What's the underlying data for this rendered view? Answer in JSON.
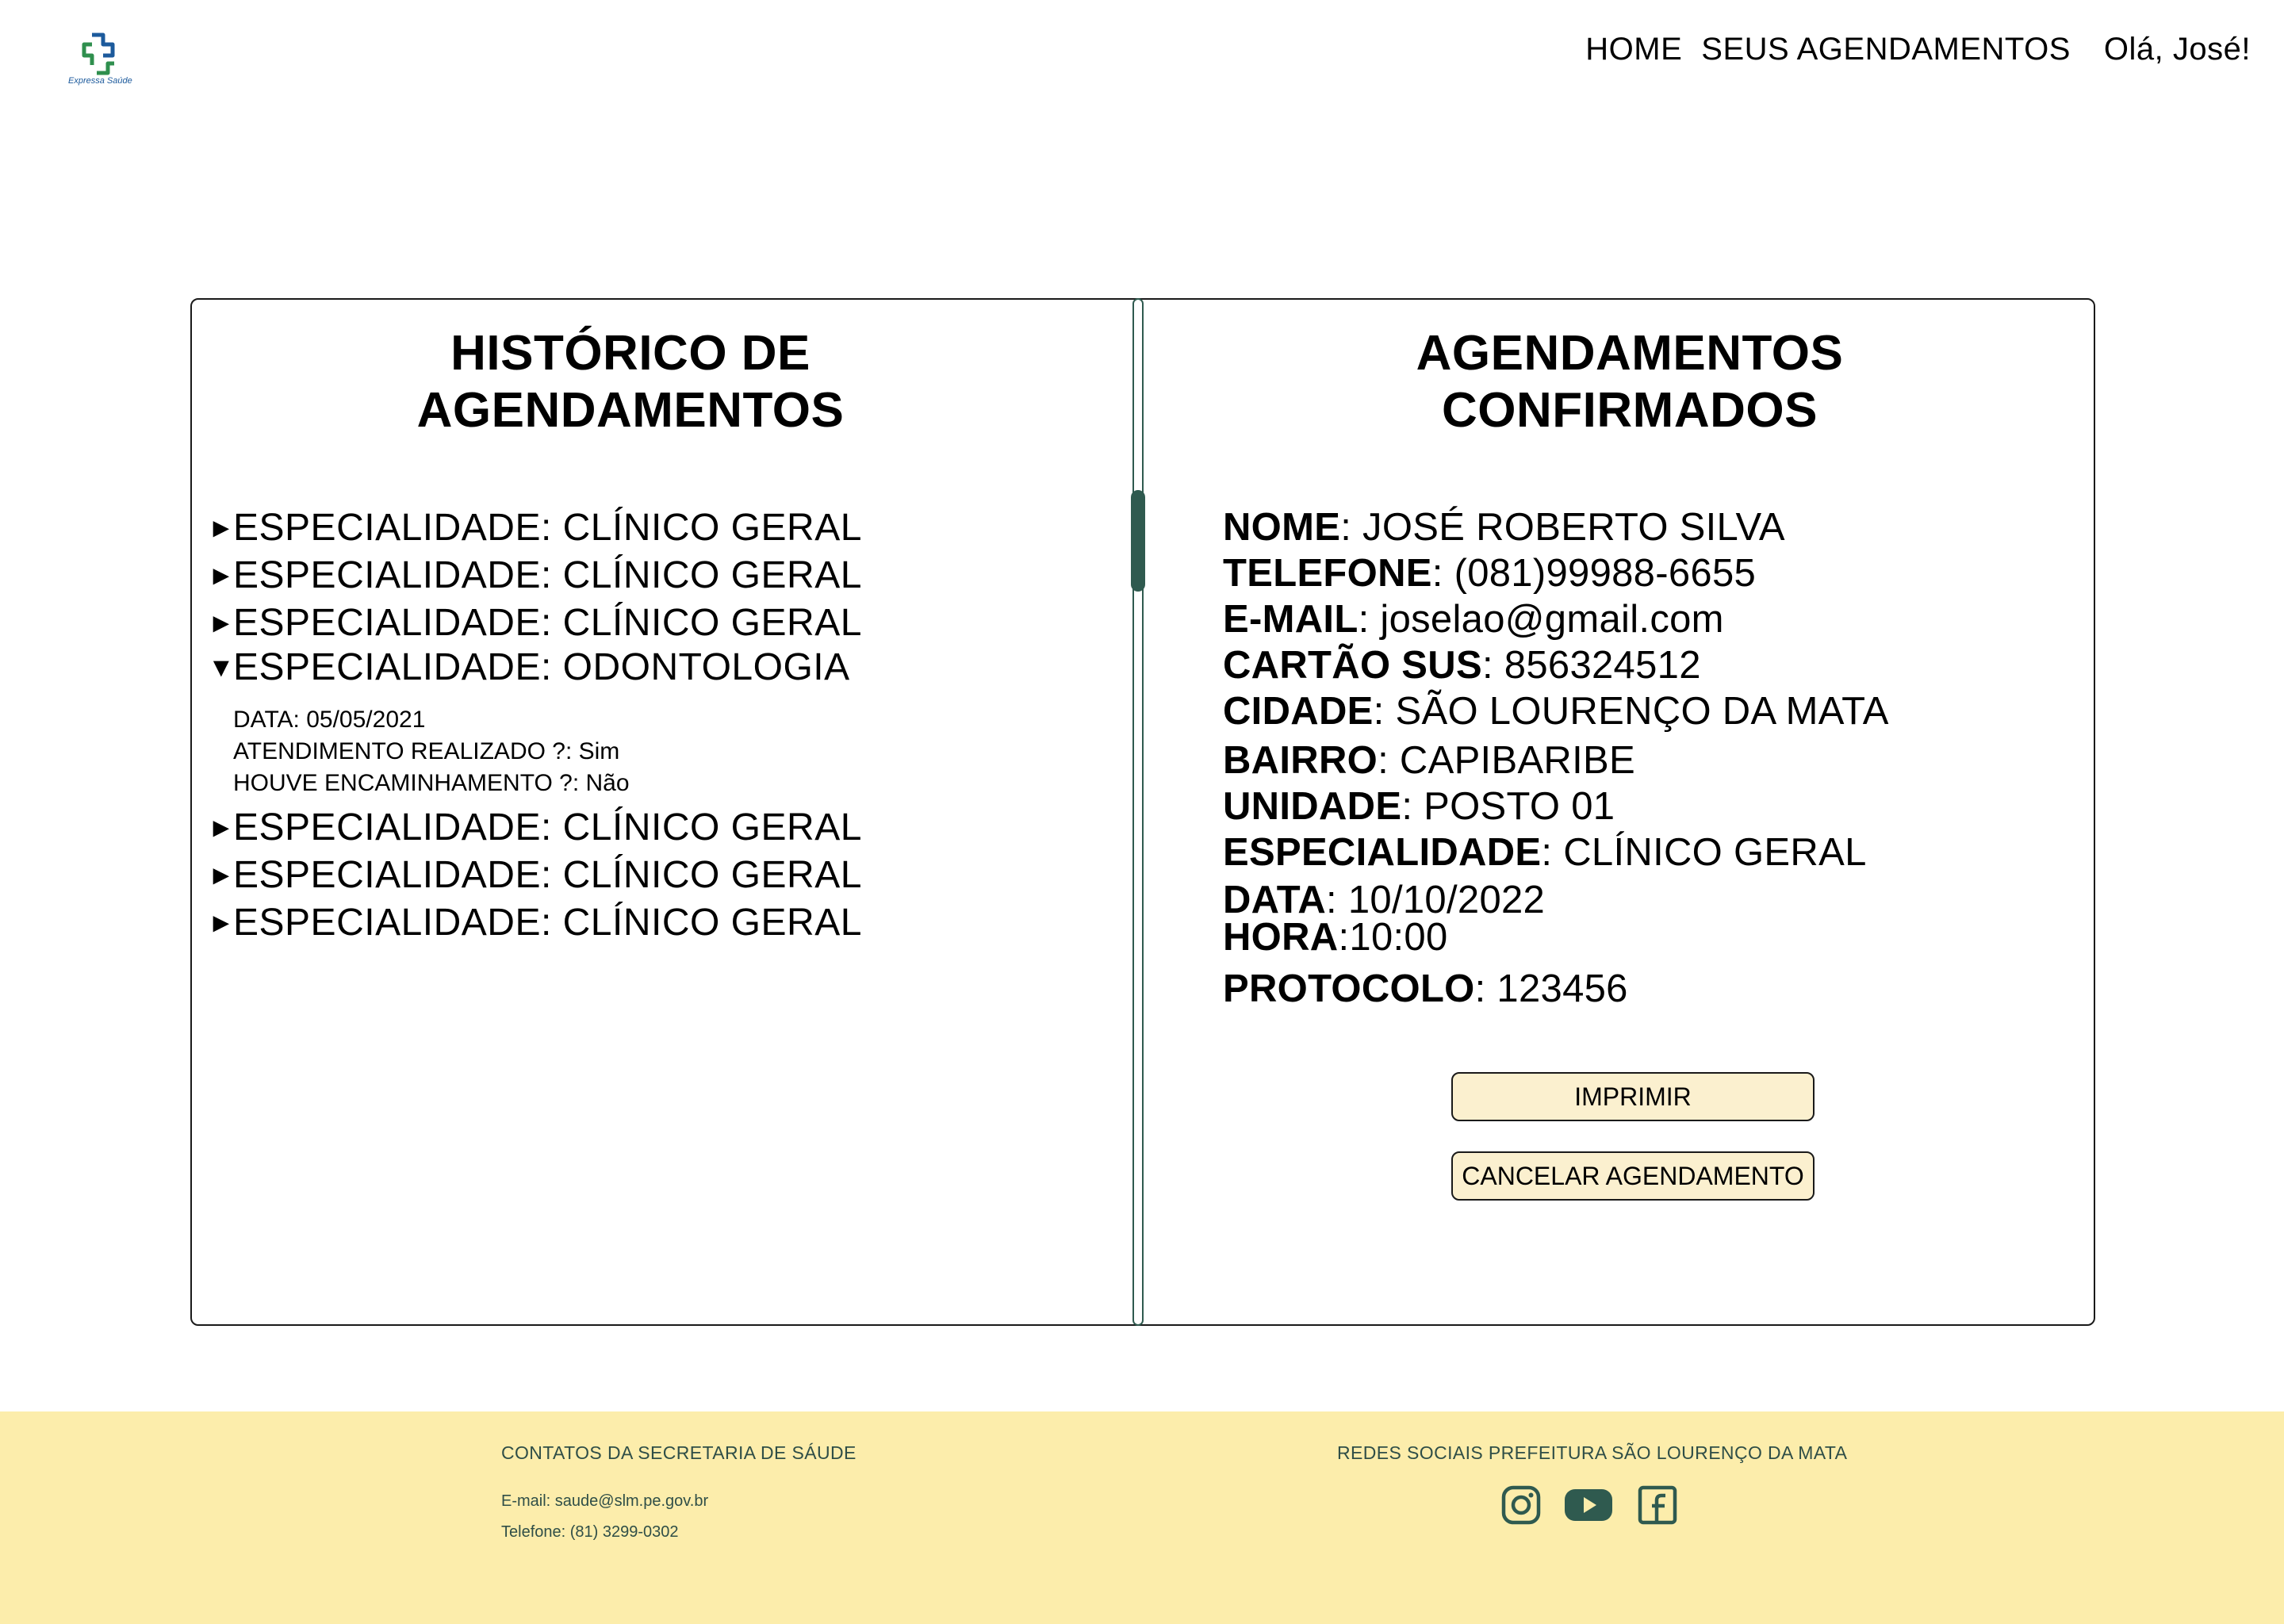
{
  "header": {
    "logo_text": "Expressa Saúde",
    "nav": {
      "home": "HOME",
      "appointments": "SEUS AGENDAMENTOS",
      "greeting": "Olá, José!"
    }
  },
  "history": {
    "title_line1": "HISTÓRICO DE",
    "title_line2": "AGENDAMENTOS",
    "items": [
      {
        "arrow": "►",
        "label": "ESPECIALIDADE: CLÍNICO GERAL"
      },
      {
        "arrow": "►",
        "label": "ESPECIALIDADE: CLÍNICO GERAL"
      },
      {
        "arrow": "►",
        "label": "ESPECIALIDADE: CLÍNICO GERAL"
      },
      {
        "arrow": "▼",
        "label": "ESPECIALIDADE: ODONTOLOGIA"
      },
      {
        "arrow": "►",
        "label": "ESPECIALIDADE: CLÍNICO GERAL"
      },
      {
        "arrow": "►",
        "label": "ESPECIALIDADE: CLÍNICO GERAL"
      },
      {
        "arrow": "►",
        "label": "ESPECIALIDADE: CLÍNICO GERAL"
      }
    ],
    "expanded_details": {
      "date": "DATA: 05/05/2021",
      "attended": "ATENDIMENTO REALIZADO ?: Sim",
      "referral": "HOUVE ENCAMINHAMENTO ?: Não"
    }
  },
  "confirmed": {
    "title_line1": "AGENDAMENTOS",
    "title_line2": "CONFIRMADOS",
    "fields": [
      {
        "label": "NOME",
        "sep": ": ",
        "value": "JOSÉ ROBERTO SILVA"
      },
      {
        "label": "TELEFONE",
        "sep": ": ",
        "value": "(081)99988-6655"
      },
      {
        "label": "E-MAIL",
        "sep": ": ",
        "value": "joselao@gmail.com"
      },
      {
        "label": "CARTÃO SUS",
        "sep": ": ",
        "value": "856324512"
      },
      {
        "label": "CIDADE",
        "sep": ": ",
        "value": "SÃO LOURENÇO DA MATA"
      },
      {
        "label": "BAIRRO",
        "sep": ": ",
        "value": "CAPIBARIBE"
      },
      {
        "label": "UNIDADE",
        "sep": ": ",
        "value": "POSTO 01"
      },
      {
        "label": "ESPECIALIDADE",
        "sep": ": ",
        "value": "CLÍNICO GERAL"
      },
      {
        "label": "DATA",
        "sep": ": ",
        "value": "10/10/2022"
      },
      {
        "label": "HORA",
        "sep": ":",
        "value": "10:00"
      },
      {
        "label": "PROTOCOLO",
        "sep": ": ",
        "value": "123456"
      }
    ],
    "print_label": "IMPRIMIR",
    "cancel_label": "CANCELAR AGENDAMENTO"
  },
  "footer": {
    "contacts_title": "CONTATOS DA SECRETARIA DE SÁUDE",
    "email": "E-mail: saude@slm.pe.gov.br",
    "phone": "Telefone: (81) 3299-0302",
    "social_title": "REDES SOCIAIS PREFEITURA SÃO LOURENÇO DA MATA",
    "social_icons": [
      "instagram-icon",
      "youtube-icon",
      "facebook-icon"
    ]
  },
  "colors": {
    "accent": "#2f5a4f",
    "button_bg": "#fbf0cf",
    "footer_bg": "#fcedab",
    "footer_text": "#2f4e47",
    "logo_blue": "#1c5a9c",
    "logo_green": "#2f8f4e"
  }
}
